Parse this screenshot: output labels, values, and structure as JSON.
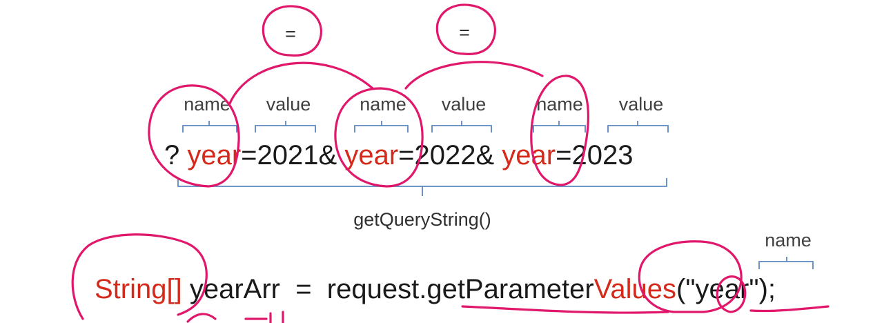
{
  "query": {
    "prefix": "? ",
    "pairs": [
      {
        "name": "year",
        "value": "2021",
        "sep": "&"
      },
      {
        "name": "year",
        "value": "2022",
        "sep": "&"
      },
      {
        "name": "year",
        "value": "2023",
        "sep": ""
      }
    ],
    "equals": "=",
    "name_label": "name",
    "value_label": "value",
    "method_label": "getQueryString()"
  },
  "code": {
    "type": "String[]",
    "variable": " yearArr",
    "assign": "=",
    "object": "request.",
    "method_prefix": "getParameter",
    "method_suffix": "Values",
    "open": "(",
    "arg": "\"year\"",
    "close": ");",
    "arg_label": "name"
  },
  "annotations": {
    "equal_mark": "="
  },
  "colors": {
    "highlight": "#d42a1c",
    "text": "#1a1a1a",
    "brace": "#5b87bf",
    "ink": "#e0176a",
    "label": "#404040"
  }
}
